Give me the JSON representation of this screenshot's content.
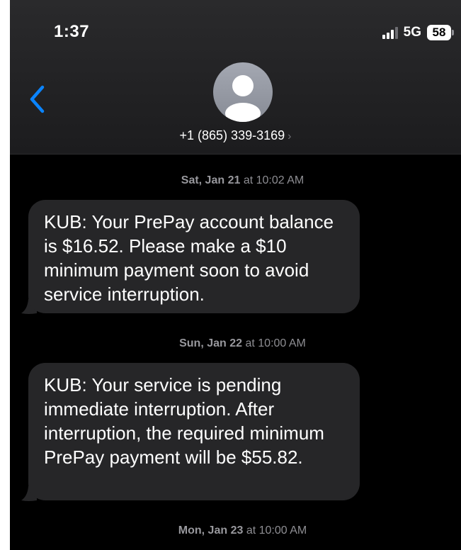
{
  "status_bar": {
    "time": "1:37",
    "network": "5G",
    "battery": "58"
  },
  "contact": {
    "name": "+1 (865) 339-3169",
    "chevron": "›"
  },
  "messages": [
    {
      "date": "Sat, Jan 21",
      "time": "at 10:02 AM",
      "text": "KUB: Your PrePay account balance is $16.52. Please make a $10 minimum payment soon to avoid service interruption."
    },
    {
      "date": "Sun, Jan 22",
      "time": "at 10:00 AM",
      "text": "KUB: Your service is pending immediate interruption. After interruption, the required minimum PrePay payment will be $55.82."
    },
    {
      "date": "Mon, Jan 23",
      "time": "at 10:00 AM"
    }
  ],
  "colors": {
    "accent": "#0a84ff",
    "bubble": "#262628",
    "background": "#000000",
    "timestamp": "#8e8e93"
  },
  "icons": {
    "back": "chevron-left-icon",
    "avatar": "person-icon",
    "signal": "cellular-signal-icon",
    "battery": "battery-icon"
  }
}
